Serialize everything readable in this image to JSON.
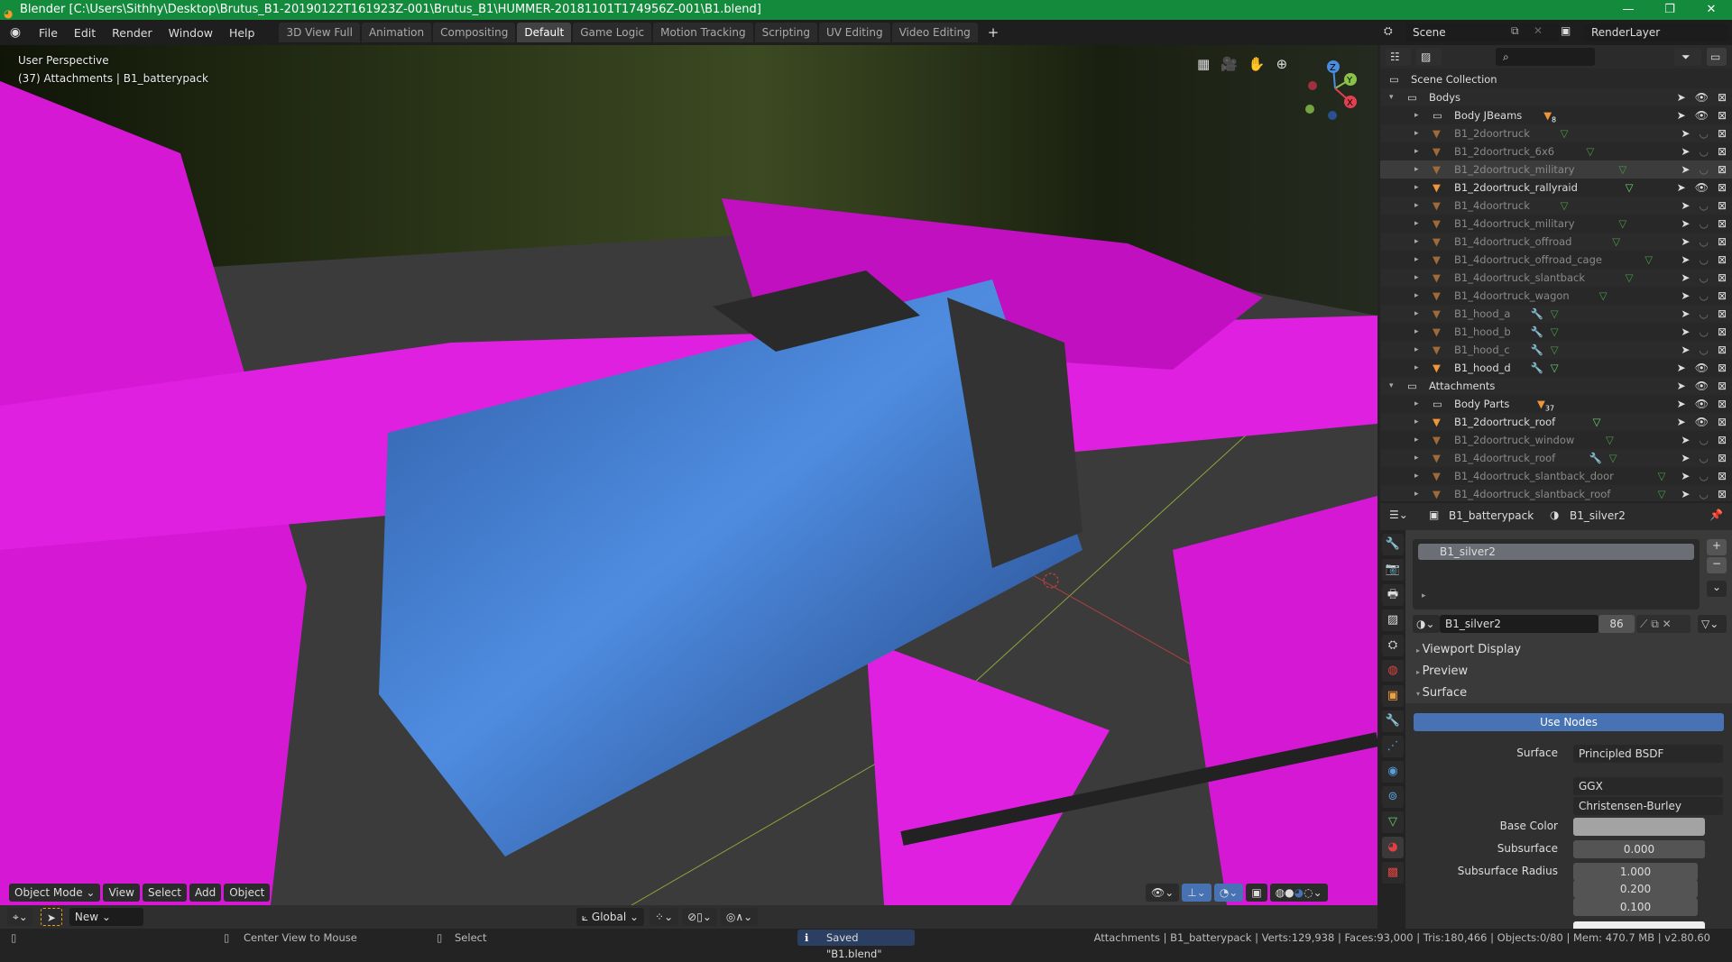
{
  "titlebar": {
    "title": "Blender [C:\\Users\\Sithhy\\Desktop\\Brutus_B1-20190122T161923Z-001\\Brutus_B1\\HUMMER-20181101T174956Z-001\\B1.blend]"
  },
  "menu": [
    "File",
    "Edit",
    "Render",
    "Window",
    "Help"
  ],
  "workspaces": [
    {
      "label": "3D View Full"
    },
    {
      "label": "Animation"
    },
    {
      "label": "Compositing"
    },
    {
      "label": "Default",
      "active": true
    },
    {
      "label": "Game Logic"
    },
    {
      "label": "Motion Tracking"
    },
    {
      "label": "Scripting"
    },
    {
      "label": "UV Editing"
    },
    {
      "label": "Video Editing"
    }
  ],
  "add_tab": "+",
  "scene": {
    "scene_name": "Scene",
    "render_layer": "RenderLayer"
  },
  "viewport": {
    "view_name": "User Perspective",
    "object_info": "(37) Attachments | B1_batterypack",
    "axes": [
      "X",
      "Y",
      "Z"
    ]
  },
  "viewport_header": {
    "mode": "Object Mode",
    "menus": [
      "View",
      "Select",
      "Add",
      "Object"
    ]
  },
  "tool_settings": {
    "brush": "New",
    "orientation": "Global"
  },
  "outliner": {
    "rows": [
      {
        "name": "Scene Collection",
        "type": "scene",
        "level": 0
      },
      {
        "name": "Bodys",
        "type": "collection",
        "level": 1,
        "expanded": true,
        "visible": true
      },
      {
        "name": "Body JBeams",
        "type": "collection",
        "level": 2,
        "badge": "8",
        "visible": true
      },
      {
        "name": "B1_2doortruck",
        "type": "object",
        "level": 2,
        "dim": true
      },
      {
        "name": "B1_2doortruck_6x6",
        "type": "object",
        "level": 2,
        "dim": true
      },
      {
        "name": "B1_2doortruck_military",
        "type": "object",
        "level": 2,
        "dim": true,
        "hover": true
      },
      {
        "name": "B1_2doortruck_rallyraid",
        "type": "object",
        "level": 2,
        "visible": true
      },
      {
        "name": "B1_4doortruck",
        "type": "object",
        "level": 2,
        "dim": true
      },
      {
        "name": "B1_4doortruck_military",
        "type": "object",
        "level": 2,
        "dim": true
      },
      {
        "name": "B1_4doortruck_offroad",
        "type": "object",
        "level": 2,
        "dim": true
      },
      {
        "name": "B1_4doortruck_offroad_cage",
        "type": "object",
        "level": 2,
        "dim": true
      },
      {
        "name": "B1_4doortruck_slantback",
        "type": "object",
        "level": 2,
        "dim": true
      },
      {
        "name": "B1_4doortruck_wagon",
        "type": "object",
        "level": 2,
        "dim": true
      },
      {
        "name": "B1_hood_a",
        "type": "object",
        "level": 2,
        "dim": true,
        "modifier": true
      },
      {
        "name": "B1_hood_b",
        "type": "object",
        "level": 2,
        "dim": true,
        "modifier": true
      },
      {
        "name": "B1_hood_c",
        "type": "object",
        "level": 2,
        "dim": true,
        "modifier": true
      },
      {
        "name": "B1_hood_d",
        "type": "object",
        "level": 2,
        "visible": true,
        "modifier": true
      },
      {
        "name": "Attachments",
        "type": "collection",
        "level": 1,
        "expanded": true,
        "visible": true
      },
      {
        "name": "Body Parts",
        "type": "collection",
        "level": 2,
        "badge": "37",
        "visible": true
      },
      {
        "name": "B1_2doortruck_roof",
        "type": "object",
        "level": 2,
        "visible": true
      },
      {
        "name": "B1_2doortruck_window",
        "type": "object",
        "level": 2,
        "dim": true
      },
      {
        "name": "B1_4doortruck_roof",
        "type": "object",
        "level": 2,
        "dim": true,
        "modifier": true
      },
      {
        "name": "B1_4doortruck_slantback_door",
        "type": "object",
        "level": 2,
        "dim": true
      },
      {
        "name": "B1_4doortruck_slantback_roof",
        "type": "object",
        "level": 2,
        "dim": true
      }
    ]
  },
  "properties": {
    "object": "B1_batterypack",
    "material": "B1_silver2",
    "slot": "B1_silver2",
    "mat_field": "B1_silver2",
    "users": "86",
    "panels": [
      "Viewport Display",
      "Preview",
      "Surface"
    ],
    "use_nodes": "Use Nodes",
    "surface_label": "Surface",
    "surface_value": "Principled BSDF",
    "distribution": "GGX",
    "subsurface_method": "Christensen-Burley",
    "base_color_label": "Base Color",
    "base_color": "#a3a3a3",
    "subsurface_label": "Subsurface",
    "subsurface_value": "0.000",
    "radius_label": "Subsurface Radius",
    "radius": [
      "1.000",
      "0.200",
      "0.100"
    ]
  },
  "statusbar": {
    "center_view": "Center View to Mouse",
    "select": "Select",
    "saved": "Saved \"B1.blend\"",
    "stats": "Attachments | B1_batterypack | Verts:129,938 | Faces:93,000 | Tris:180,466 | Objects:0/80 | Mem: 470.7 MB | v2.80.60"
  },
  "colors": {
    "titlebar": "#138a3c",
    "accent": "#4772b3",
    "magenta": "#e020e0"
  }
}
